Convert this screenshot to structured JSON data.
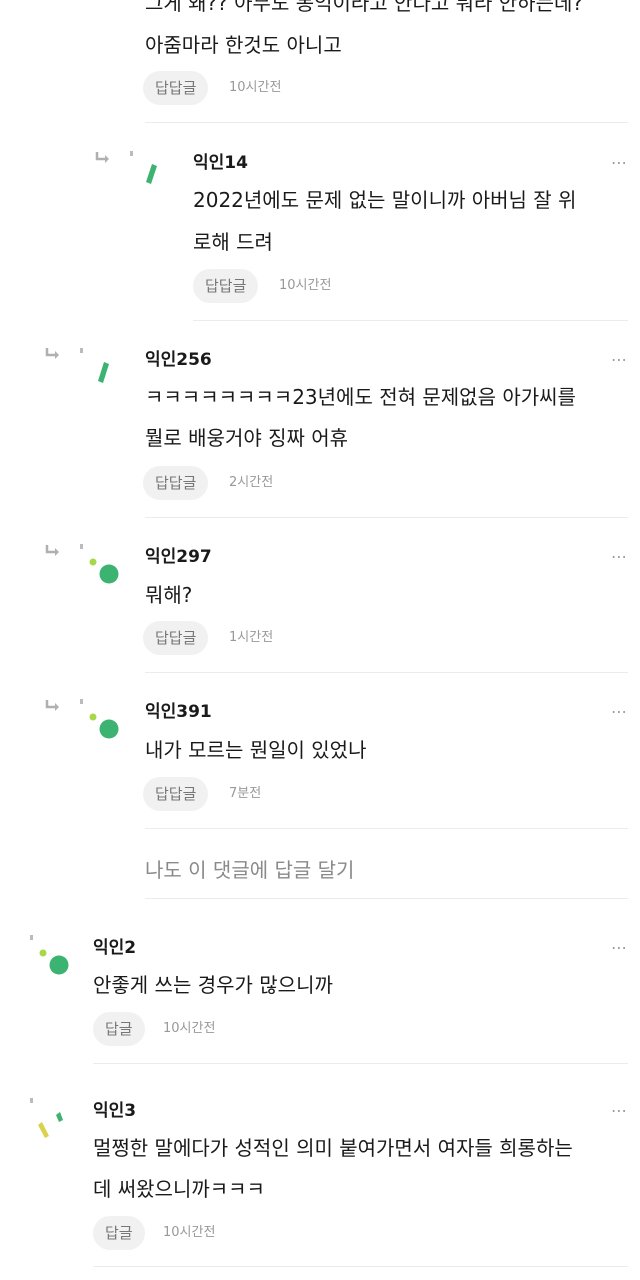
{
  "top_comment": {
    "text_line1": "그게 왜?? 아무도 봉익이라고 안다고 뭐라 안하는데?",
    "text_line2": "아줌마라 한것도 아니고",
    "reply_label": "답답글",
    "time": "10시간전"
  },
  "replies": [
    {
      "name": "익인14",
      "line1": "2022년에도 문제 없는 말이니까 아버님 잘 위",
      "line2": "로해 드려",
      "reply_label": "답답글",
      "time": "10시간전",
      "more": "⋯",
      "avatar": "green-leaf-icon"
    },
    {
      "name": "익인256",
      "line1": "ㅋㅋㅋㅋㅋㅋㅋㅋ23년에도 전혀 문제없음 아가씨를",
      "line2": "뭘로 배웅거야 징짜 어휴",
      "reply_label": "답답글",
      "time": "2시간전",
      "more": "⋯",
      "avatar": "green-leaf-icon"
    },
    {
      "name": "익인297",
      "line1": "뭐해?",
      "reply_label": "답답글",
      "time": "1시간전",
      "more": "⋯",
      "avatar": "green-dots-icon"
    },
    {
      "name": "익인391",
      "line1": "내가 모르는 뭔일이 있었나",
      "reply_label": "답답글",
      "time": "7분전",
      "more": "⋯",
      "avatar": "green-dots-icon"
    }
  ],
  "reply_prompt": "나도 이 댓글에 답글 달기",
  "comments": [
    {
      "name": "익인2",
      "line1": "안좋게 쓰는 경우가 많으니까",
      "reply_label": "답글",
      "time": "10시간전",
      "more": "⋯",
      "avatar": "green-dots-icon"
    },
    {
      "name": "익인3",
      "line1": "멀쩡한 말에다가 성적인 의미 붙여가면서 여자들 희롱하는",
      "line2": "데 써왔으니까ㅋㅋㅋ",
      "reply_label": "답글",
      "time": "10시간전",
      "more": "⋯",
      "avatar": "yellow-leaf-icon"
    }
  ],
  "colors": {
    "green": "#3cb371",
    "light_green": "#a5d84b",
    "yellow": "#d9d24a",
    "pill_bg": "#f1f1f1"
  }
}
